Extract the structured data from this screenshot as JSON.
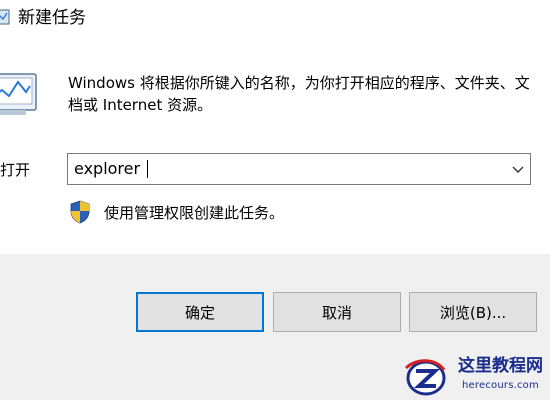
{
  "window": {
    "title": "新建任务"
  },
  "dialog": {
    "description": "Windows 将根据你所键入的名称，为你打开相应的程序、文件夹、文档或 Internet 资源。",
    "open_label": "打开",
    "command_value": "explorer",
    "admin_note": "使用管理权限创建此任务。"
  },
  "buttons": {
    "ok": "确定",
    "cancel": "取消",
    "browse": "浏览(B)..."
  },
  "watermark": {
    "title": "这里教程网",
    "url": "herecours.com"
  },
  "icons": {
    "app": "task-manager-icon",
    "shield": "uac-shield-icon",
    "dropdown": "chevron-down-icon"
  },
  "colors": {
    "accent_focus": "#0078d7",
    "footer_bg": "#f0f0f0",
    "button_bg": "#e1e1e1",
    "watermark_blue": "#1a2d8f",
    "watermark_red": "#d42020"
  }
}
